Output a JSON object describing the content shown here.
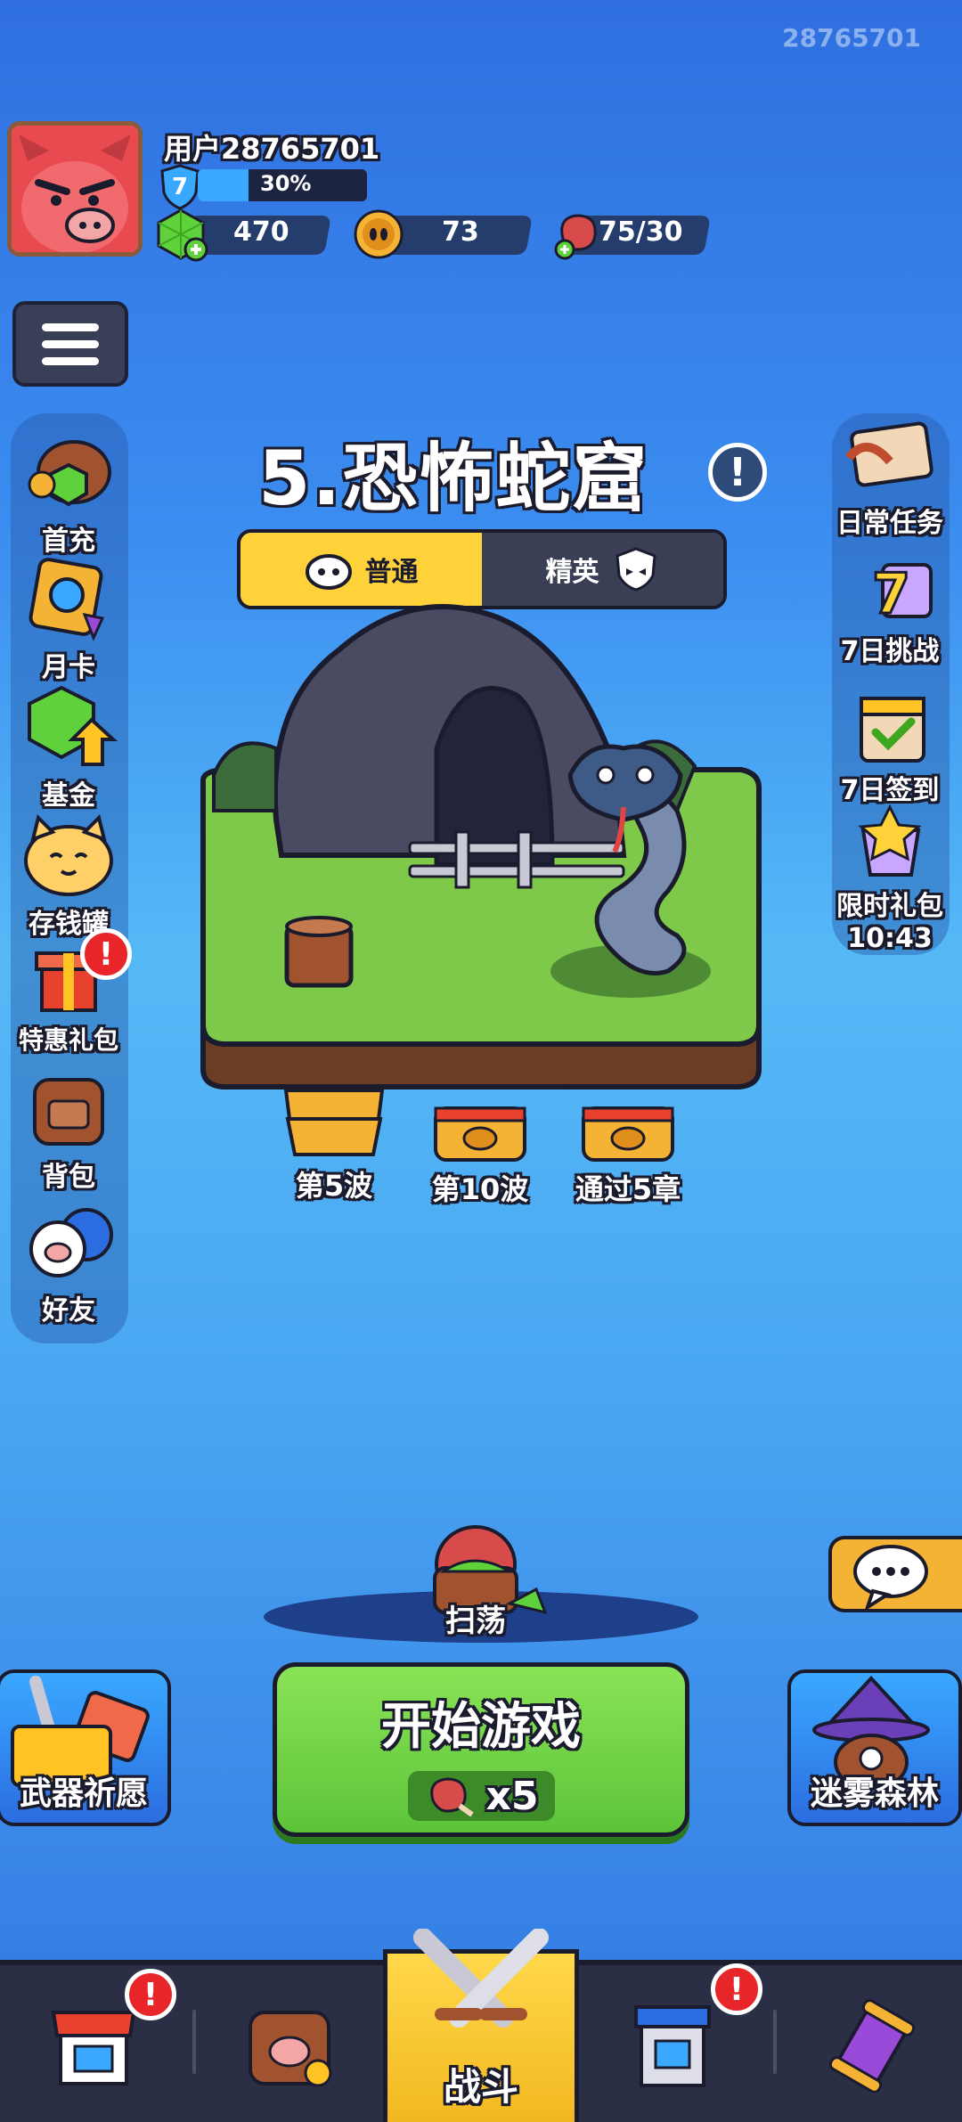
{
  "top_id": "28765701",
  "player": {
    "name": "用户28765701",
    "level": "7",
    "xp_percent_label": "30%",
    "xp_fraction": 0.3,
    "gems": "470",
    "coins": "73",
    "stamina": "75/30"
  },
  "stage": {
    "title": "5.恐怖蛇窟",
    "info_icon": "!"
  },
  "mode_toggle": {
    "normal_label": "普通",
    "elite_label": "精英",
    "selected": "普通"
  },
  "left_menu": {
    "items": [
      {
        "label": "首充",
        "icon": "treasure-gems-icon"
      },
      {
        "label": "月卡",
        "icon": "monthly-card-icon"
      },
      {
        "label": "基金",
        "icon": "fund-gem-icon"
      },
      {
        "label": "存钱罐",
        "icon": "lucky-cat-icon"
      },
      {
        "label": "特惠礼包",
        "icon": "gift-box-icon"
      },
      {
        "label": "背包",
        "icon": "backpack-icon"
      },
      {
        "label": "好友",
        "icon": "friends-icon"
      }
    ]
  },
  "right_menu": {
    "items": [
      {
        "label": "日常任务",
        "icon": "scroll-icon"
      },
      {
        "label": "7日挑战",
        "icon": "seven-day-challenge-icon"
      },
      {
        "label": "7日签到",
        "icon": "seven-day-signin-icon"
      },
      {
        "label": "限时礼包",
        "icon": "limited-gift-icon"
      }
    ],
    "limited_timer": "10:43"
  },
  "rewards": [
    {
      "label": "第5波"
    },
    {
      "label": "第10波"
    },
    {
      "label": "通过5章"
    }
  ],
  "sweep_label": "扫荡",
  "start_button": {
    "label": "开始游戏",
    "cost": "x5"
  },
  "weapon_wish_label": "武器祈愿",
  "fog_forest_label": "迷雾森林",
  "bottom_nav": {
    "battle_label": "战斗",
    "alert_symbol": "!"
  },
  "colors": {
    "accent_yellow": "#ffd23a",
    "start_green": "#6fd447",
    "alert_red": "#e8262a"
  }
}
